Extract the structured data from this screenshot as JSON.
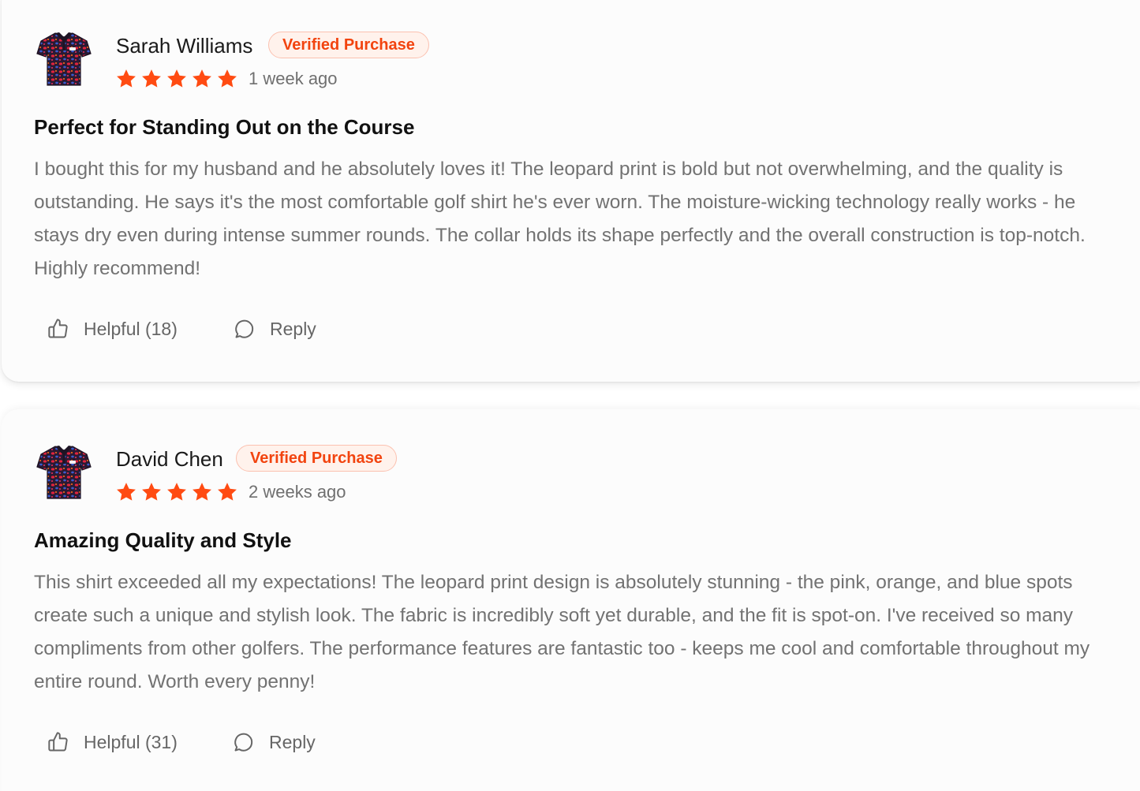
{
  "colors": {
    "accent": "#f2440f",
    "star": "#ff4b12",
    "badge_bg": "#fff2ec",
    "badge_border": "#fbc1b0",
    "body_text": "#727272",
    "title_text": "#111111",
    "card_bg": "#fcfcfc"
  },
  "reviews": [
    {
      "avatar_icon": "leopard-golf-shirt-avatar",
      "name": "Sarah Williams",
      "badge": "Verified Purchase",
      "rating": 5,
      "time_ago": "1 week ago",
      "title": "Perfect for Standing Out on the Course",
      "body": "I bought this for my husband and he absolutely loves it! The leopard print is bold but not overwhelming, and the quality is outstanding. He says it's the most comfortable golf shirt he's ever worn. The moisture-wicking technology really works - he stays dry even during intense summer rounds. The collar holds its shape perfectly and the overall construction is top-notch. Highly recommend!",
      "helpful_label": "Helpful (18)",
      "reply_label": "Reply"
    },
    {
      "avatar_icon": "leopard-golf-shirt-avatar",
      "name": "David Chen",
      "badge": "Verified Purchase",
      "rating": 5,
      "time_ago": "2 weeks ago",
      "title": "Amazing Quality and Style",
      "body": "This shirt exceeded all my expectations! The leopard print design is absolutely stunning - the pink, orange, and blue spots create such a unique and stylish look. The fabric is incredibly soft yet durable, and the fit is spot-on. I've received so many compliments from other golfers. The performance features are fantastic too - keeps me cool and comfortable throughout my entire round. Worth every penny!",
      "helpful_label": "Helpful (31)",
      "reply_label": "Reply"
    }
  ]
}
